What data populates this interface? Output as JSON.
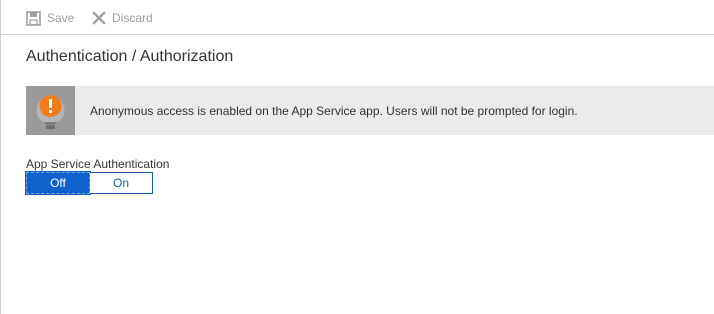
{
  "toolbar": {
    "save": {
      "label": "Save",
      "icon": "save-icon",
      "enabled": false
    },
    "discard": {
      "label": "Discard",
      "icon": "close-icon",
      "enabled": false
    }
  },
  "page": {
    "title": "Authentication / Authorization"
  },
  "notice": {
    "icon": "warning-icon",
    "text": "Anonymous access is enabled on the App Service app. Users will not be prompted for login."
  },
  "auth_setting": {
    "label": "App Service Authentication",
    "options": [
      "Off",
      "On"
    ],
    "selected": "Off"
  },
  "colors": {
    "accent": "#0f62c9",
    "warning": "#f07c1e",
    "disabled_text": "#a0a0a0",
    "notice_bg": "#ebebeb"
  }
}
